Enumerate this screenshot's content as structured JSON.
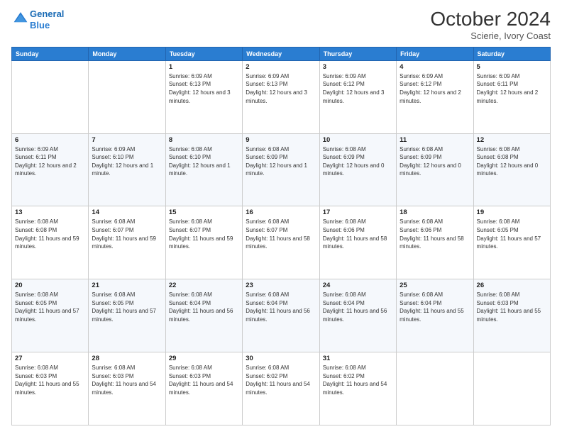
{
  "logo": {
    "line1": "General",
    "line2": "Blue"
  },
  "header": {
    "month": "October 2024",
    "location": "Scierie, Ivory Coast"
  },
  "weekdays": [
    "Sunday",
    "Monday",
    "Tuesday",
    "Wednesday",
    "Thursday",
    "Friday",
    "Saturday"
  ],
  "weeks": [
    [
      {
        "day": "",
        "info": ""
      },
      {
        "day": "",
        "info": ""
      },
      {
        "day": "1",
        "info": "Sunrise: 6:09 AM\nSunset: 6:13 PM\nDaylight: 12 hours and 3 minutes."
      },
      {
        "day": "2",
        "info": "Sunrise: 6:09 AM\nSunset: 6:13 PM\nDaylight: 12 hours and 3 minutes."
      },
      {
        "day": "3",
        "info": "Sunrise: 6:09 AM\nSunset: 6:12 PM\nDaylight: 12 hours and 3 minutes."
      },
      {
        "day": "4",
        "info": "Sunrise: 6:09 AM\nSunset: 6:12 PM\nDaylight: 12 hours and 2 minutes."
      },
      {
        "day": "5",
        "info": "Sunrise: 6:09 AM\nSunset: 6:11 PM\nDaylight: 12 hours and 2 minutes."
      }
    ],
    [
      {
        "day": "6",
        "info": "Sunrise: 6:09 AM\nSunset: 6:11 PM\nDaylight: 12 hours and 2 minutes."
      },
      {
        "day": "7",
        "info": "Sunrise: 6:09 AM\nSunset: 6:10 PM\nDaylight: 12 hours and 1 minute."
      },
      {
        "day": "8",
        "info": "Sunrise: 6:08 AM\nSunset: 6:10 PM\nDaylight: 12 hours and 1 minute."
      },
      {
        "day": "9",
        "info": "Sunrise: 6:08 AM\nSunset: 6:09 PM\nDaylight: 12 hours and 1 minute."
      },
      {
        "day": "10",
        "info": "Sunrise: 6:08 AM\nSunset: 6:09 PM\nDaylight: 12 hours and 0 minutes."
      },
      {
        "day": "11",
        "info": "Sunrise: 6:08 AM\nSunset: 6:09 PM\nDaylight: 12 hours and 0 minutes."
      },
      {
        "day": "12",
        "info": "Sunrise: 6:08 AM\nSunset: 6:08 PM\nDaylight: 12 hours and 0 minutes."
      }
    ],
    [
      {
        "day": "13",
        "info": "Sunrise: 6:08 AM\nSunset: 6:08 PM\nDaylight: 11 hours and 59 minutes."
      },
      {
        "day": "14",
        "info": "Sunrise: 6:08 AM\nSunset: 6:07 PM\nDaylight: 11 hours and 59 minutes."
      },
      {
        "day": "15",
        "info": "Sunrise: 6:08 AM\nSunset: 6:07 PM\nDaylight: 11 hours and 59 minutes."
      },
      {
        "day": "16",
        "info": "Sunrise: 6:08 AM\nSunset: 6:07 PM\nDaylight: 11 hours and 58 minutes."
      },
      {
        "day": "17",
        "info": "Sunrise: 6:08 AM\nSunset: 6:06 PM\nDaylight: 11 hours and 58 minutes."
      },
      {
        "day": "18",
        "info": "Sunrise: 6:08 AM\nSunset: 6:06 PM\nDaylight: 11 hours and 58 minutes."
      },
      {
        "day": "19",
        "info": "Sunrise: 6:08 AM\nSunset: 6:05 PM\nDaylight: 11 hours and 57 minutes."
      }
    ],
    [
      {
        "day": "20",
        "info": "Sunrise: 6:08 AM\nSunset: 6:05 PM\nDaylight: 11 hours and 57 minutes."
      },
      {
        "day": "21",
        "info": "Sunrise: 6:08 AM\nSunset: 6:05 PM\nDaylight: 11 hours and 57 minutes."
      },
      {
        "day": "22",
        "info": "Sunrise: 6:08 AM\nSunset: 6:04 PM\nDaylight: 11 hours and 56 minutes."
      },
      {
        "day": "23",
        "info": "Sunrise: 6:08 AM\nSunset: 6:04 PM\nDaylight: 11 hours and 56 minutes."
      },
      {
        "day": "24",
        "info": "Sunrise: 6:08 AM\nSunset: 6:04 PM\nDaylight: 11 hours and 56 minutes."
      },
      {
        "day": "25",
        "info": "Sunrise: 6:08 AM\nSunset: 6:04 PM\nDaylight: 11 hours and 55 minutes."
      },
      {
        "day": "26",
        "info": "Sunrise: 6:08 AM\nSunset: 6:03 PM\nDaylight: 11 hours and 55 minutes."
      }
    ],
    [
      {
        "day": "27",
        "info": "Sunrise: 6:08 AM\nSunset: 6:03 PM\nDaylight: 11 hours and 55 minutes."
      },
      {
        "day": "28",
        "info": "Sunrise: 6:08 AM\nSunset: 6:03 PM\nDaylight: 11 hours and 54 minutes."
      },
      {
        "day": "29",
        "info": "Sunrise: 6:08 AM\nSunset: 6:03 PM\nDaylight: 11 hours and 54 minutes."
      },
      {
        "day": "30",
        "info": "Sunrise: 6:08 AM\nSunset: 6:02 PM\nDaylight: 11 hours and 54 minutes."
      },
      {
        "day": "31",
        "info": "Sunrise: 6:08 AM\nSunset: 6:02 PM\nDaylight: 11 hours and 54 minutes."
      },
      {
        "day": "",
        "info": ""
      },
      {
        "day": "",
        "info": ""
      }
    ]
  ]
}
